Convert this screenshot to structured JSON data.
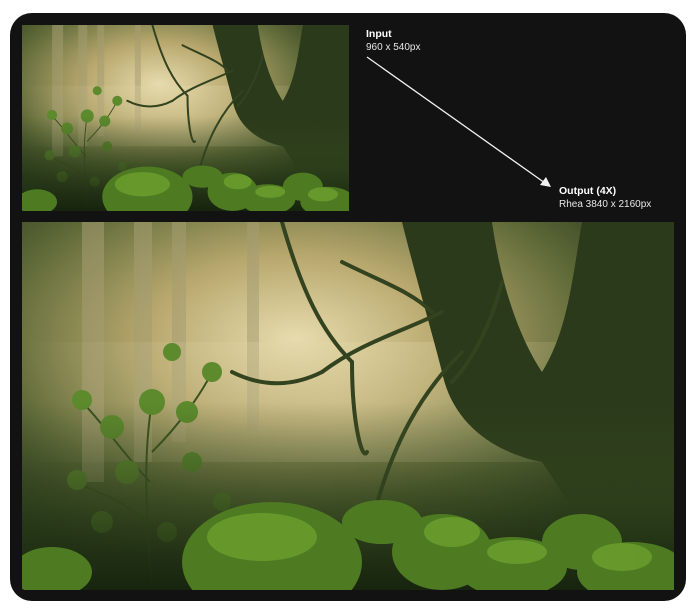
{
  "input": {
    "title": "Input",
    "resolution": "960 x 540px"
  },
  "output": {
    "title": "Output (4X)",
    "resolution": "Rhea 3840 x 2160px"
  },
  "colors": {
    "frame_bg": "#121212",
    "text": "#ffffff",
    "arrow": "#f2f2f2"
  },
  "icons": {
    "arrow": "diagonal-arrow-icon"
  }
}
